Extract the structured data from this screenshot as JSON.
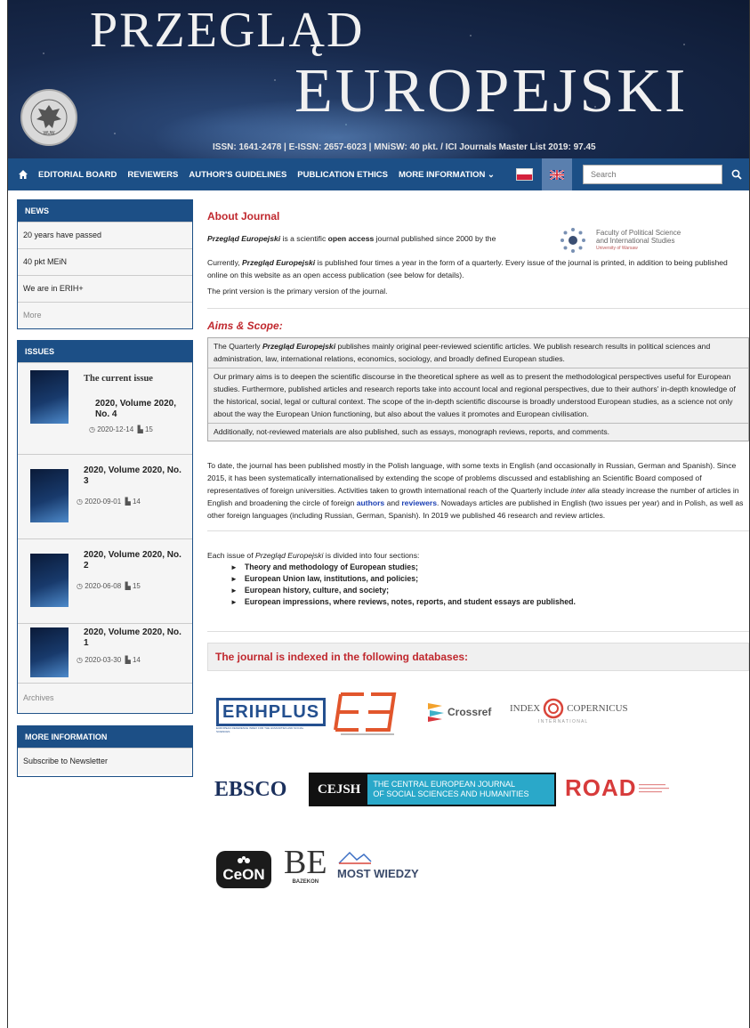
{
  "header": {
    "title_line1": "PRZEGLĄD",
    "title_line2": "EUROPEJSKI",
    "issn_line": "ISSN: 1641-2478 | E-ISSN: 2657-6023 | MNiSW: 40 pkt. / ICI Journals Master List 2019: 97.45",
    "seal_text": "WUW"
  },
  "nav": {
    "items": [
      "EDITORIAL BOARD",
      "REVIEWERS",
      "AUTHOR'S GUIDELINES",
      "PUBLICATION ETHICS",
      "MORE INFORMATION ⌄"
    ],
    "search_placeholder": "Search"
  },
  "sidebar": {
    "news": {
      "title": "NEWS",
      "items": [
        "20 years have passed",
        "40 pkt MEiN",
        "We are in ERIH+"
      ],
      "more": "More"
    },
    "issues": {
      "title": "ISSUES",
      "current_label": "The current issue",
      "list": [
        {
          "title": "2020, Volume 2020, No. 4",
          "date": "2020-12-14",
          "count": "15"
        },
        {
          "title": "2020, Volume 2020, No. 3",
          "date": "2020-09-01",
          "count": "14"
        },
        {
          "title": "2020, Volume 2020, No. 2",
          "date": "2020-06-08",
          "count": "15"
        },
        {
          "title": "2020, Volume 2020, No. 1",
          "date": "2020-03-30",
          "count": "14"
        }
      ],
      "archives": "Archives"
    },
    "more_info": {
      "title": "MORE INFORMATION",
      "items": [
        "Subscribe to Newsletter"
      ]
    }
  },
  "main": {
    "about_title": "About Journal",
    "about_p1_em": "Przegląd Europejski",
    "about_p1_text": " is a scientific ",
    "about_p1_bold": "open access",
    "about_p1_rest": " journal published since 2000 by the",
    "faculty_line1": "Faculty of Political Science",
    "faculty_line2": "and International Studies",
    "faculty_line3": "University of Warsaw",
    "about_p2_a": "Currently, ",
    "about_p2_em": "Przegląd Europejski",
    "about_p2_b": " is published four times a year in the form of a quarterly. Every issue of the journal is printed, in addition to being published online on this website as an open access publication (see below for details).",
    "about_p3": "The print version is the primary version of the journal.",
    "aims_title": "Aims & Scope:",
    "aims_p1_a": "The Quarterly ",
    "aims_p1_em": "Przegląd Europejski",
    "aims_p1_b": " publishes mainly original peer-reviewed scientific articles. We publish research results in political sciences and administration, law, international relations, economics, sociology, and broadly defined European studies.",
    "aims_p2": "Our primary aims is to deepen the scientific discourse in the theoretical sphere as well as to present the methodological perspectives useful for European studies. Furthermore, published articles and research reports take into account local and regional perspectives, due to their authors' in-depth knowledge of the historical, social, legal or cultural context. The scope of the in-depth scientific discourse is broadly understood European studies, as a science not only about the way the European Union functioning, but also about the values it promotes and European civilisation.",
    "aims_p3": "Additionally, not-reviewed materials are also published, such as essays, monograph reviews, reports, and comments.",
    "history_a": "To date, the journal has been published mostly in the Polish language, with some texts in English (and occasionally in Russian, German and Spanish). Since 2015, it has been systematically internationalised by extending the scope of problems discussed and establishing an Scientific Board composed of representatives of foreign universities. Activities taken to growth international reach of the Quarterly include ",
    "history_em": "inter alia",
    "history_b": " steady increase the number of articles in English and broadening the circle of foreign ",
    "history_link1": "authors",
    "history_c": " and ",
    "history_link2": "reviewers",
    "history_d": ". Nowadays articles are published in English (two issues per year) and in Polish, as well as other foreign languages (including Russian, German, Spanish). In 2019 we published 46 research and review articles.",
    "sections_a": "Each issue of ",
    "sections_em": "Przegląd Europejski",
    "sections_b": " is divided into four sections:",
    "sections": [
      "Theory and methodology of European studies;",
      "European Union law, institutions, and policies;",
      "European history, culture, and society;",
      "European impressions, where reviews, notes, reports, and student essays are published."
    ],
    "db_title": "The journal is indexed in the following databases:"
  },
  "logos": {
    "erih": "ERIHPLUS",
    "erih_sub": "EUROPEAN REFERENCE INDEX FOR THE HUMANITIES AND SOCIAL SCIENCES",
    "crossref": "Crossref",
    "index_a": "INDEX",
    "index_b": "COPERNICUS",
    "index_sub": "I N T E R N A T I O N A L",
    "ebsco": "EBSCO",
    "cejsh_abbr": "CEJSH",
    "cejsh_l1": "THE CENTRAL EUROPEAN JOURNAL",
    "cejsh_l2": "OF SOCIAL SCIENCES AND HUMANITIES",
    "road": "ROAD",
    "ceon": "CeON",
    "bazekon": "BAZEKON",
    "most": "MOST WIEDZY"
  },
  "colors": {
    "nav_blue": "#1c4f86",
    "heading_red": "#c0282e",
    "link_blue": "#1b3fb3"
  }
}
